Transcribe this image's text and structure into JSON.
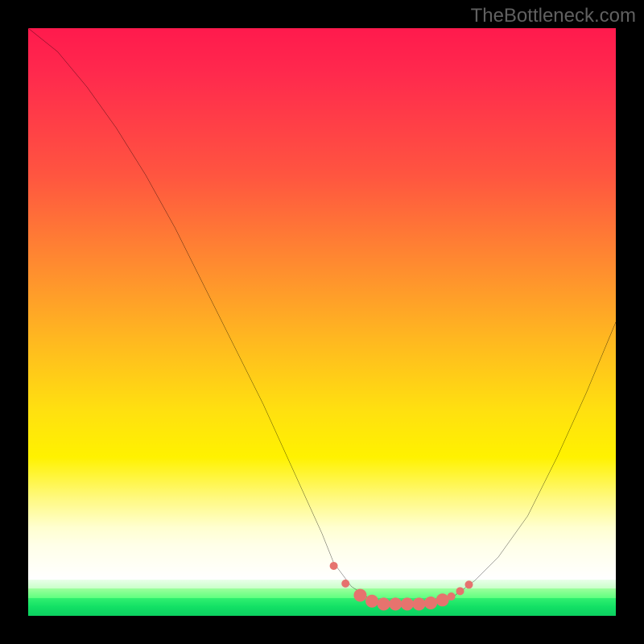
{
  "watermark": "TheBottleneck.com",
  "chart_data": {
    "type": "line",
    "title": "",
    "xlabel": "",
    "ylabel": "",
    "xlim": [
      0,
      100
    ],
    "ylim": [
      0,
      100
    ],
    "grid": false,
    "legend": false,
    "series": [
      {
        "name": "bottleneck-curve",
        "stroke": "#000000",
        "x": [
          0,
          5,
          10,
          15,
          20,
          25,
          30,
          35,
          40,
          45,
          50,
          52,
          55,
          58,
          60,
          63,
          66,
          68,
          72,
          76,
          80,
          85,
          90,
          95,
          100
        ],
        "values": [
          100,
          96,
          90,
          83,
          75,
          66,
          56,
          46,
          36,
          25,
          14,
          9,
          5,
          3,
          2,
          2,
          2,
          2,
          3,
          6,
          10,
          17,
          27,
          38,
          50
        ]
      }
    ],
    "markers": {
      "name": "range-markers",
      "color": "#e6736e",
      "radius_small": 5,
      "radius_large": 8,
      "points": [
        {
          "x": 52.0,
          "y": 8.5,
          "r": 5
        },
        {
          "x": 54.0,
          "y": 5.5,
          "r": 5
        },
        {
          "x": 56.5,
          "y": 3.5,
          "r": 8
        },
        {
          "x": 58.5,
          "y": 2.5,
          "r": 8
        },
        {
          "x": 60.5,
          "y": 2.0,
          "r": 8
        },
        {
          "x": 62.5,
          "y": 2.0,
          "r": 8
        },
        {
          "x": 64.5,
          "y": 2.0,
          "r": 8
        },
        {
          "x": 66.5,
          "y": 2.0,
          "r": 8
        },
        {
          "x": 68.5,
          "y": 2.2,
          "r": 8
        },
        {
          "x": 70.5,
          "y": 2.7,
          "r": 8
        },
        {
          "x": 72.0,
          "y": 3.3,
          "r": 5
        },
        {
          "x": 73.5,
          "y": 4.2,
          "r": 5
        },
        {
          "x": 75.0,
          "y": 5.3,
          "r": 5
        }
      ]
    },
    "background_type": "vertical-gradient",
    "background_stops": [
      {
        "pos": 0.0,
        "color": "#ff1a4d"
      },
      {
        "pos": 0.4,
        "color": "#ff8a30"
      },
      {
        "pos": 0.73,
        "color": "#fff200"
      },
      {
        "pos": 0.9,
        "color": "#fffff0"
      },
      {
        "pos": 0.95,
        "color": "#c8ffc8"
      },
      {
        "pos": 1.0,
        "color": "#0cd060"
      }
    ]
  }
}
